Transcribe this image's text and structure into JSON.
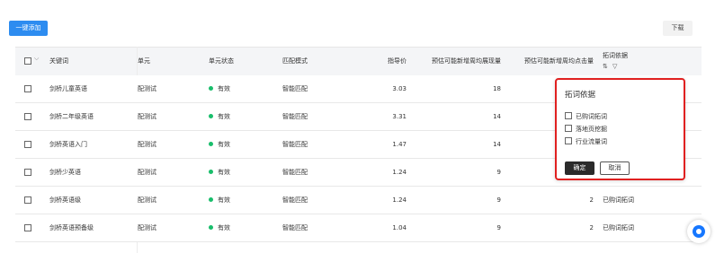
{
  "toolbar": {
    "batch_add_label": "一键添加",
    "download_label": "下载"
  },
  "table": {
    "headers": {
      "keyword": "关键词",
      "unit": "单元",
      "unit_status": "单元状态",
      "match_mode": "匹配模式",
      "guide_price": "指导价",
      "est_impressions": "预估可能新增周均展现量",
      "est_clicks": "预估可能新增周均点击量",
      "basis": "拓词依据"
    },
    "rows": [
      {
        "keyword": "剑桥儿童英语",
        "unit": "配测试",
        "status": "有效",
        "match": "智能匹配",
        "price": "3.03",
        "impressions": "18",
        "clicks": "",
        "basis": ""
      },
      {
        "keyword": "剑桥二年级英语",
        "unit": "配测试",
        "status": "有效",
        "match": "智能匹配",
        "price": "3.31",
        "impressions": "14",
        "clicks": "",
        "basis": ""
      },
      {
        "keyword": "剑桥英语入门",
        "unit": "配测试",
        "status": "有效",
        "match": "智能匹配",
        "price": "1.47",
        "impressions": "14",
        "clicks": "",
        "basis": ""
      },
      {
        "keyword": "剑桥少英语",
        "unit": "配测试",
        "status": "有效",
        "match": "智能匹配",
        "price": "1.24",
        "impressions": "9",
        "clicks": "",
        "basis": ""
      },
      {
        "keyword": "剑桥英语级",
        "unit": "配测试",
        "status": "有效",
        "match": "智能匹配",
        "price": "1.24",
        "impressions": "9",
        "clicks": "2",
        "basis": "已购词拓词"
      },
      {
        "keyword": "剑桥英语预备级",
        "unit": "配测试",
        "status": "有效",
        "match": "智能匹配",
        "price": "1.04",
        "impressions": "9",
        "clicks": "2",
        "basis": "已购词拓词"
      }
    ]
  },
  "popover": {
    "title": "拓词依据",
    "options": [
      "已购词拓词",
      "落地页挖掘",
      "行业流量词"
    ],
    "ok_label": "确定",
    "cancel_label": "取消"
  },
  "colors": {
    "primary": "#2d8cf0",
    "status_green": "#19be6b",
    "highlight_red": "#e02020"
  }
}
